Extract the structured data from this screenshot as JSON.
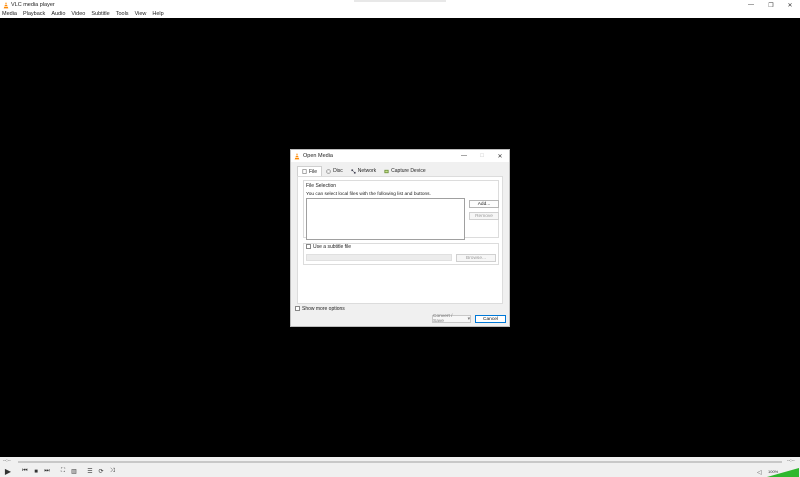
{
  "window": {
    "title": "VLC media player",
    "controls": {
      "minimize": "—",
      "restore": "❐",
      "close": "✕"
    }
  },
  "menu": [
    "Media",
    "Playback",
    "Audio",
    "Video",
    "Subtitle",
    "Tools",
    "View",
    "Help"
  ],
  "dialog": {
    "title": "Open Media",
    "tabs": [
      "File",
      "Disc",
      "Network",
      "Capture Device"
    ],
    "active_tab": "File",
    "file_selection": {
      "label": "File Selection",
      "hint": "You can select local files with the following list and buttons.",
      "add_label": "Add...",
      "remove_label": "Remove"
    },
    "subtitle": {
      "checkbox_label": "Use a subtitle file",
      "checked": false,
      "browse_label": "Browse..."
    },
    "show_more_label": "Show more options",
    "convert_label": "Convert / Save",
    "convert_arrow": "▾",
    "cancel_label": "Cancel"
  },
  "player": {
    "elapsed": "--:--",
    "remaining": "--:--",
    "volume_percent": "100%",
    "volume_level": 1.0,
    "buttons": [
      "play-icon",
      "previous-icon",
      "stop-icon",
      "next-icon",
      "fullscreen-icon",
      "extended-settings-icon",
      "playlist-icon",
      "loop-icon",
      "shuffle-icon"
    ]
  },
  "colors": {
    "accent": "#ff8800",
    "video_bg": "#000000",
    "cancel_border": "#0078d7",
    "volume_fill": "#2db82d"
  }
}
